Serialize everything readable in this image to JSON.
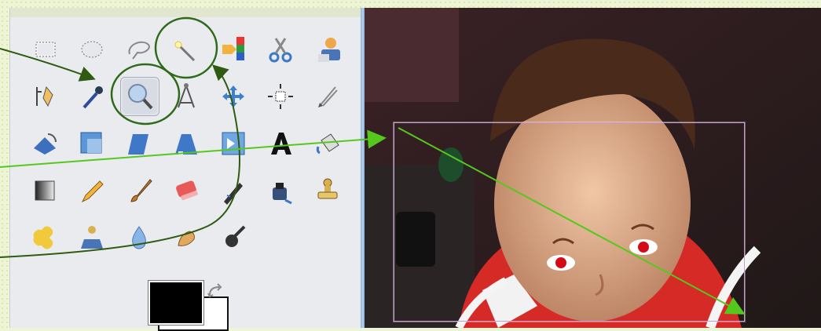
{
  "toolbox": {
    "tools": [
      {
        "name": "rect-select-icon"
      },
      {
        "name": "ellipse-select-icon"
      },
      {
        "name": "free-select-icon"
      },
      {
        "name": "fuzzy-select-icon"
      },
      {
        "name": "select-by-color-icon"
      },
      {
        "name": "scissors-select-icon"
      },
      {
        "name": "foreground-select-icon"
      },
      {
        "name": "paths-icon"
      },
      {
        "name": "color-picker-icon"
      },
      {
        "name": "zoom-icon",
        "active": true
      },
      {
        "name": "measure-icon"
      },
      {
        "name": "move-icon"
      },
      {
        "name": "align-icon"
      },
      {
        "name": "crop-icon"
      },
      {
        "name": "rotate-icon"
      },
      {
        "name": "scale-icon"
      },
      {
        "name": "shear-icon"
      },
      {
        "name": "perspective-icon"
      },
      {
        "name": "flip-icon"
      },
      {
        "name": "text-icon"
      },
      {
        "name": "bucket-fill-icon"
      },
      {
        "name": "blend-icon"
      },
      {
        "name": "pencil-icon"
      },
      {
        "name": "paintbrush-icon"
      },
      {
        "name": "eraser-icon"
      },
      {
        "name": "airbrush-icon"
      },
      {
        "name": "ink-icon"
      },
      {
        "name": "clone-icon"
      },
      {
        "name": "heal-icon"
      },
      {
        "name": "perspective-clone-icon"
      },
      {
        "name": "blur-icon"
      },
      {
        "name": "smudge-icon"
      },
      {
        "name": "dodge-burn-icon"
      }
    ],
    "foreground_color": "#000000",
    "background_color": "#ffffff"
  },
  "annotation": {
    "circle_color": "#2e6a1a",
    "arrow_dark_color": "#2e5a12",
    "arrow_light_color": "#55c81e",
    "selection_frame_color": "#c79ad1"
  }
}
